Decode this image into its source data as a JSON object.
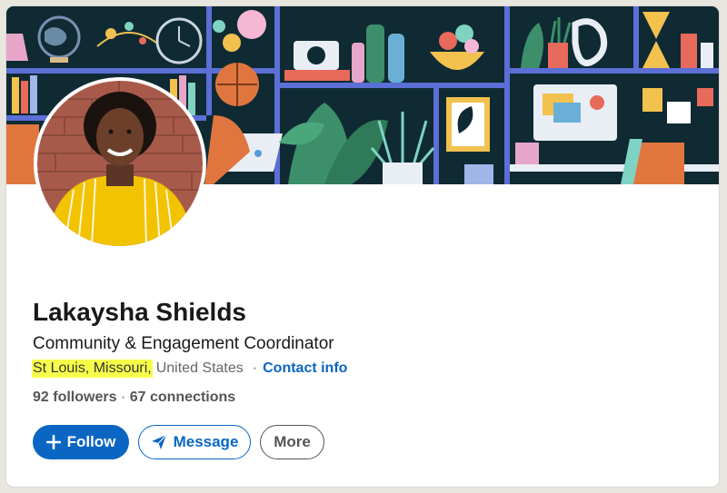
{
  "profile": {
    "name": "Lakaysha Shields",
    "headline": "Community & Engagement Coordinator",
    "location_city": "St Louis, Missouri,",
    "location_country": "United States",
    "separator": "·",
    "contact_label": "Contact info",
    "followers": "92 followers",
    "stats_separator": " · ",
    "connections": "67 connections"
  },
  "actions": {
    "follow_label": "Follow",
    "message_label": "Message",
    "more_label": "More"
  },
  "icons": {
    "follow": "plus-icon",
    "message": "paper-plane-icon"
  },
  "colors": {
    "accent": "#0a66c2",
    "highlight": "#f7ff4a",
    "banner_bg": "#0f2a33",
    "shelf": "#5b6fd6"
  }
}
